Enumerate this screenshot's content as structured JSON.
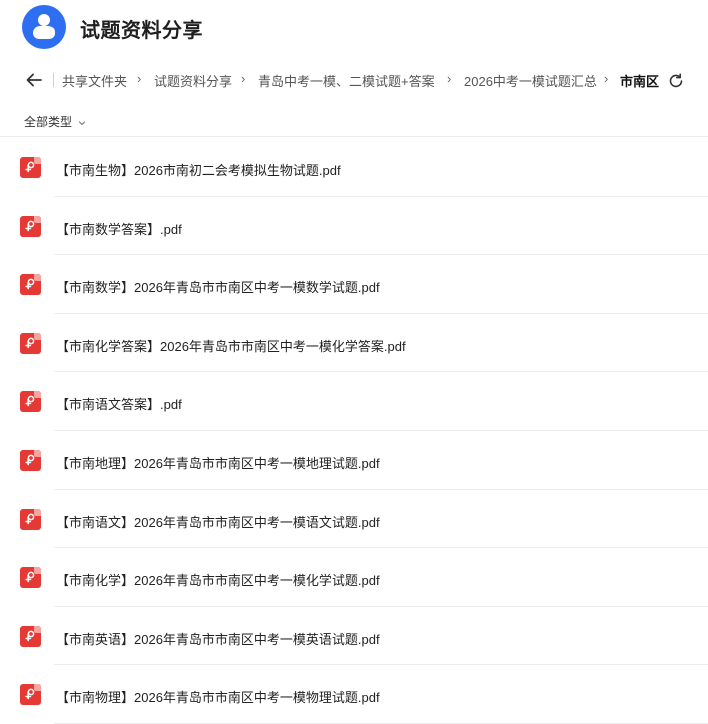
{
  "header": {
    "title": "试题资料分享",
    "logo_icon": "users-icon",
    "brand_color": "#2e6ff2"
  },
  "breadcrumb": {
    "items": [
      "共享文件夹",
      "试题资料分享",
      "青岛中考一模、二模试题+答案",
      "2026中考一模试题汇总"
    ],
    "current": "市南区"
  },
  "filter": {
    "label": "全部类型"
  },
  "files": [
    {
      "name": "【市南生物】2026市南初二会考模拟生物试题.pdf",
      "icon": "pdf-icon"
    },
    {
      "name": "【市南数学答案】.pdf",
      "icon": "pdf-icon"
    },
    {
      "name": "【市南数学】2026年青岛市市南区中考一模数学试题.pdf",
      "icon": "pdf-icon"
    },
    {
      "name": "【市南化学答案】2026年青岛市市南区中考一模化学答案.pdf",
      "icon": "pdf-icon"
    },
    {
      "name": "【市南语文答案】.pdf",
      "icon": "pdf-icon"
    },
    {
      "name": "【市南地理】2026年青岛市市南区中考一模地理试题.pdf",
      "icon": "pdf-icon"
    },
    {
      "name": "【市南语文】2026年青岛市市南区中考一模语文试题.pdf",
      "icon": "pdf-icon"
    },
    {
      "name": "【市南化学】2026年青岛市市南区中考一模化学试题.pdf",
      "icon": "pdf-icon"
    },
    {
      "name": "【市南英语】2026年青岛市市南区中考一模英语试题.pdf",
      "icon": "pdf-icon"
    },
    {
      "name": "【市南物理】2026年青岛市市南区中考一模物理试题.pdf",
      "icon": "pdf-icon"
    }
  ],
  "colors": {
    "pdf_red": "#e53935",
    "text": "#222222",
    "muted": "#555555"
  }
}
